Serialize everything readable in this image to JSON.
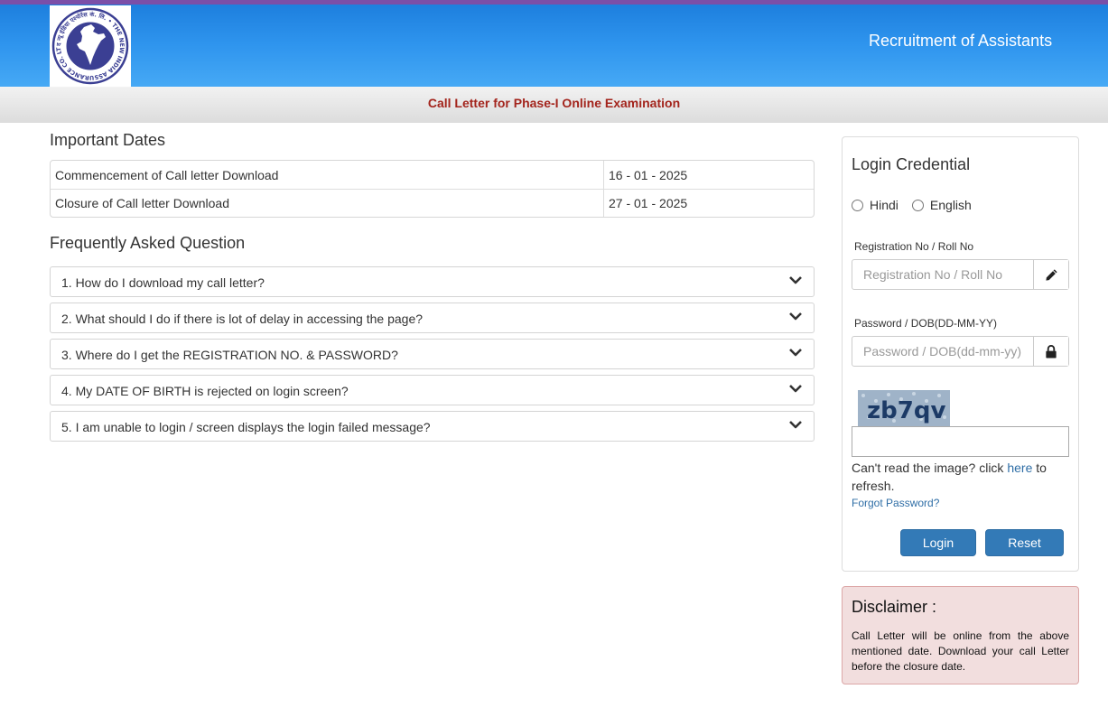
{
  "header": {
    "title": "Recruitment of Assistants",
    "logo": {
      "icon": "india-map-seal-icon",
      "text": "द न्यू इंडिया एश्योरेंस कं. लि. • THE NEW INDIA ASSURANCE CO. LTD."
    }
  },
  "subbar": {
    "title": "Call Letter for Phase-I Online Examination"
  },
  "dates": {
    "heading": "Important Dates",
    "rows": [
      {
        "label": "Commencement of Call letter Download",
        "value": "16 - 01 - 2025"
      },
      {
        "label": "Closure of Call letter Download",
        "value": "27 - 01 - 2025"
      }
    ]
  },
  "faq": {
    "heading": "Frequently Asked Question",
    "items": [
      "1. How do I download my call letter?",
      "2. What should I do if there is lot of delay in accessing the page?",
      "3. Where do I get the REGISTRATION NO. & PASSWORD?",
      "4. My DATE OF BIRTH is rejected on login screen?",
      "5. I am unable to login / screen displays the login failed message?"
    ],
    "icon": "chevron-down-icon"
  },
  "login": {
    "heading": "Login Credential",
    "languages": [
      "Hindi",
      "English"
    ],
    "registration": {
      "label": "Registration No / Roll No",
      "placeholder": "Registration No / Roll No",
      "icon": "pencil-icon"
    },
    "password": {
      "label": "Password / DOB(DD-MM-YY)",
      "placeholder": "Password / DOB(dd-mm-yy)",
      "icon": "lock-icon"
    },
    "captcha": {
      "text": "zb7qv"
    },
    "refresh_prefix": "Can't read the image? click ",
    "refresh_link": "here",
    "refresh_suffix": " to refresh.",
    "forgot": "Forgot Password?",
    "login_button": "Login",
    "reset_button": "Reset",
    "accent": "#337ab7"
  },
  "disclaimer": {
    "heading": "Disclaimer :",
    "text": "Call Letter will be online from the above mentioned date. Download your call Letter before the closure date.",
    "background": "#f2dede"
  },
  "colors": {
    "header_gradient_top": "#1d7fde",
    "header_gradient_bottom": "#46a9f5",
    "top_stripe": "#7b4fa8",
    "subbar_title": "#a3241c"
  }
}
